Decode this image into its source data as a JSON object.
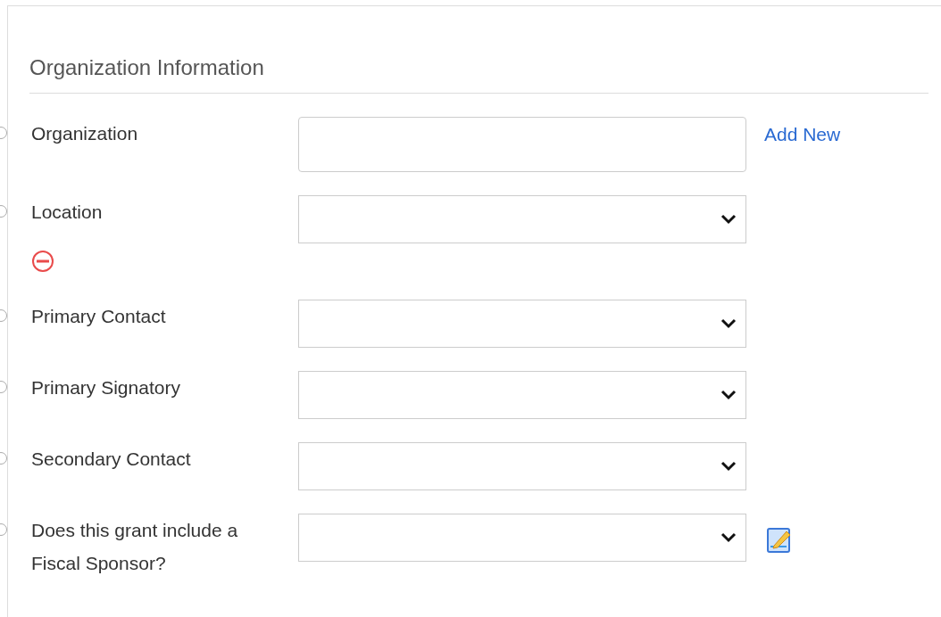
{
  "section": {
    "title": "Organization Information"
  },
  "fields": [
    {
      "label": "Organization",
      "kind": "text",
      "selected": false,
      "action": {
        "kind": "link",
        "label": "Add New"
      }
    },
    {
      "label": "Location",
      "kind": "select",
      "selected": false,
      "removable": true
    },
    {
      "label": "Primary Contact",
      "kind": "select",
      "selected": false
    },
    {
      "label": "Primary Signatory",
      "kind": "select",
      "selected": false
    },
    {
      "label": "Secondary Contact",
      "kind": "select",
      "selected": false
    },
    {
      "label": "Does this grant include a Fiscal Sponsor?",
      "kind": "select",
      "selected": false,
      "action": {
        "kind": "edit"
      }
    }
  ]
}
